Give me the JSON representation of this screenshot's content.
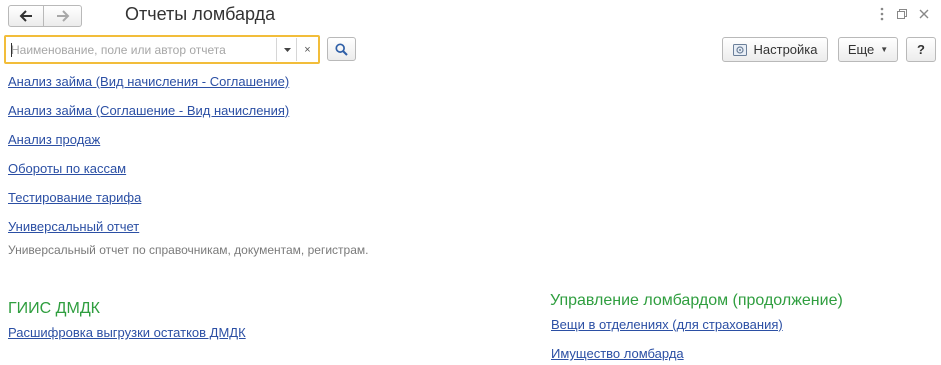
{
  "window": {
    "title": "Отчеты ломбарда",
    "icons": [
      "more-vertical-icon",
      "restore-icon",
      "close-icon"
    ]
  },
  "nav": {
    "back_icon": "arrow-left-icon",
    "forward_icon": "arrow-right-icon"
  },
  "search": {
    "placeholder": "Наименование, поле или автор отчета",
    "value": "",
    "clear_label": "×",
    "search_icon": "search-icon"
  },
  "toolbar": {
    "settings_label": "Настройка",
    "more_label": "Еще",
    "help_label": "?"
  },
  "reports": [
    {
      "label": "Анализ займа (Вид начисления - Соглашение)"
    },
    {
      "label": "Анализ займа (Соглашение - Вид начисления)"
    },
    {
      "label": "Анализ продаж"
    },
    {
      "label": "Обороты по кассам"
    },
    {
      "label": "Тестирование тарифа"
    },
    {
      "label": "Универсальный отчет",
      "description": "Универсальный отчет по справочникам, документам, регистрам."
    }
  ],
  "groups": [
    {
      "title": "ГИИС ДМДК",
      "items": [
        {
          "label": "Расшифровка выгрузки остатков ДМДК"
        }
      ]
    },
    {
      "title": "Управление ломбардом (продолжение)",
      "items": [
        {
          "label": "Вещи в отделениях (для страхования)"
        },
        {
          "label": "Имущество ломбарда"
        }
      ]
    }
  ],
  "colors": {
    "link": "#2b4fa4",
    "group_title": "#2f9e3f",
    "focus_border": "#f2bd3a"
  }
}
